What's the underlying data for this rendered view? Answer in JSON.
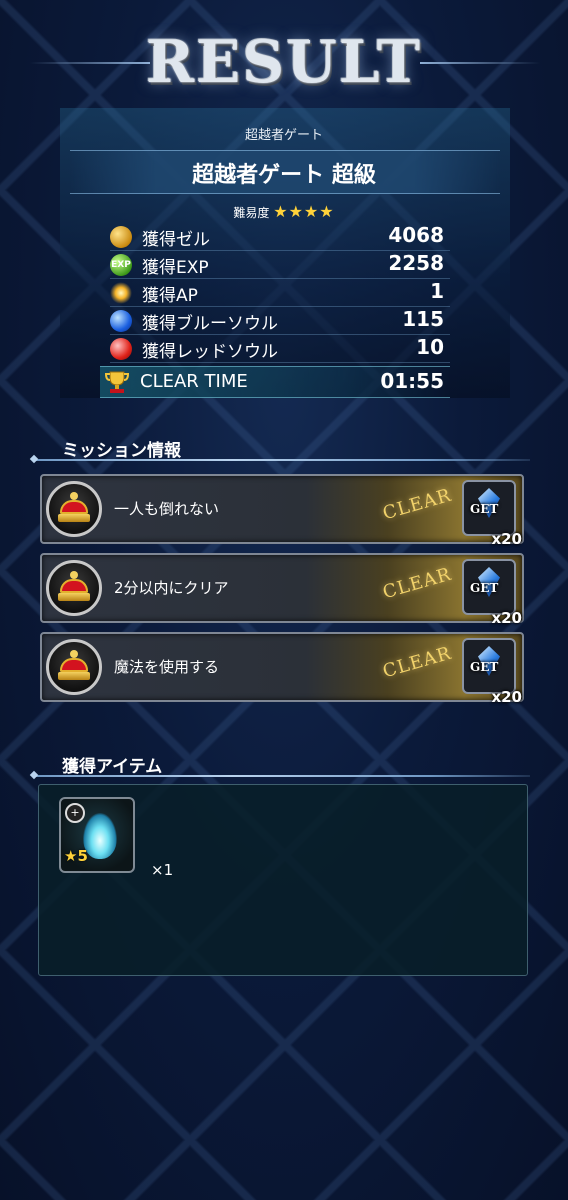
{
  "title": "RESULT",
  "quest": {
    "subtitle": "超越者ゲート",
    "name": "超越者ゲート 超級",
    "difficulty_label": "難易度",
    "difficulty_stars": "★★★★"
  },
  "rewards": [
    {
      "icon": "gil-coin-icon",
      "label": "獲得ゼル",
      "value": "4068"
    },
    {
      "icon": "exp-icon",
      "label": "獲得EXP",
      "value": "2258"
    },
    {
      "icon": "ap-sparkle-icon",
      "label": "獲得AP",
      "value": "1"
    },
    {
      "icon": "blue-soul-icon",
      "label": "獲得ブルーソウル",
      "value": "115"
    },
    {
      "icon": "red-soul-icon",
      "label": "獲得レッドソウル",
      "value": "10"
    }
  ],
  "exp_icon_text": "EXP",
  "clear_time": {
    "label": "CLEAR TIME",
    "value": "01:55"
  },
  "missions": {
    "header": "ミッション情報",
    "items": [
      {
        "text": "一人も倒れない",
        "status": "CLEAR",
        "reward_label": "GET",
        "reward_qty": "x20"
      },
      {
        "text": "2分以内にクリア",
        "status": "CLEAR",
        "reward_label": "GET",
        "reward_qty": "x20"
      },
      {
        "text": "魔法を使用する",
        "status": "CLEAR",
        "reward_label": "GET",
        "reward_qty": "x20"
      }
    ]
  },
  "items": {
    "header": "獲得アイテム",
    "list": [
      {
        "rarity": "★5",
        "qty": "×1",
        "type_icon": "+"
      }
    ]
  }
}
